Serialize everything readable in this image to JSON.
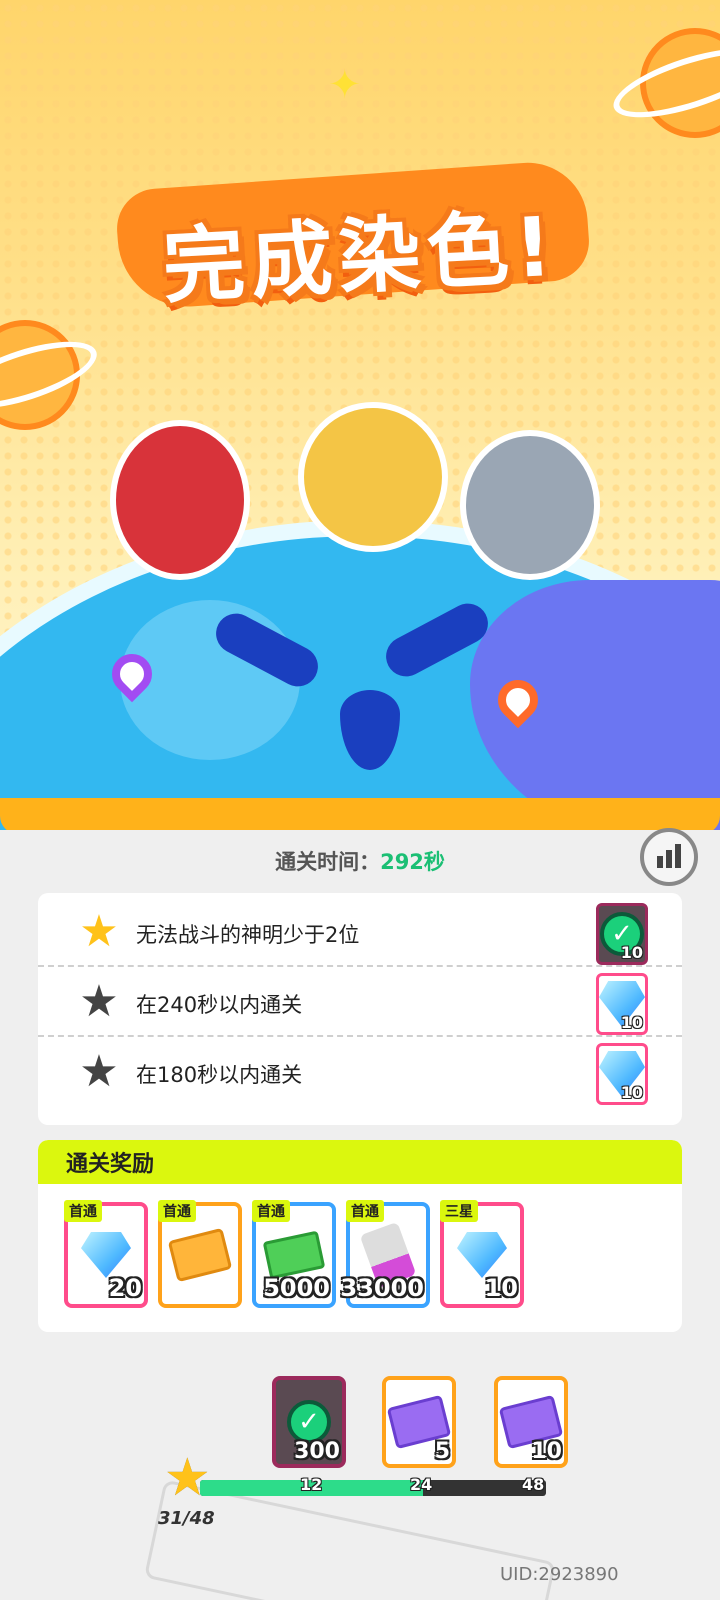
{
  "banner": {
    "title": "完成染色!"
  },
  "clear_time": {
    "label": "通关时间：",
    "value": "292秒"
  },
  "objectives": [
    {
      "text": "无法战斗的神明少于2位",
      "achieved": true,
      "reward_icon": "check-token-icon",
      "reward_count": "10"
    },
    {
      "text": "在240秒以内通关",
      "achieved": false,
      "reward_icon": "diamond-icon",
      "reward_count": "10"
    },
    {
      "text": "在180秒以内通关",
      "achieved": false,
      "reward_icon": "diamond-icon",
      "reward_count": "10"
    }
  ],
  "rewards": {
    "title": "通关奖励",
    "items": [
      {
        "tag": "首通",
        "icon": "diamond-icon",
        "count": "20",
        "border_color": "#ff4c8b"
      },
      {
        "tag": "首通",
        "icon": "gold-ticket-icon",
        "count": "",
        "border_color": "#ffa21a"
      },
      {
        "tag": "首通",
        "icon": "cash-icon",
        "count": "5000",
        "border_color": "#3aa3ff"
      },
      {
        "tag": "首通",
        "icon": "paint-tube-icon",
        "count": "33000",
        "border_color": "#3aa3ff"
      },
      {
        "tag": "三星",
        "icon": "diamond-icon",
        "count": "10",
        "border_color": "#ff4c8b"
      }
    ]
  },
  "star_progress": {
    "current": 31,
    "total": 48,
    "count_text": "31/48",
    "milestones": [
      {
        "label": "12",
        "icon": "check-token-icon",
        "count": "300",
        "border_color": "#9c2a5c"
      },
      {
        "label": "24",
        "icon": "purple-ticket-icon",
        "count": "5",
        "border_color": "#ffa21a"
      },
      {
        "label": "48",
        "icon": "purple-ticket-icon",
        "count": "10",
        "border_color": "#ffa21a"
      }
    ]
  },
  "uid": "UID:2923890",
  "colors": {
    "accent_green": "#1bbf74",
    "highlight_yellow": "#dbf70e",
    "title_orange": "#f57a1a"
  }
}
